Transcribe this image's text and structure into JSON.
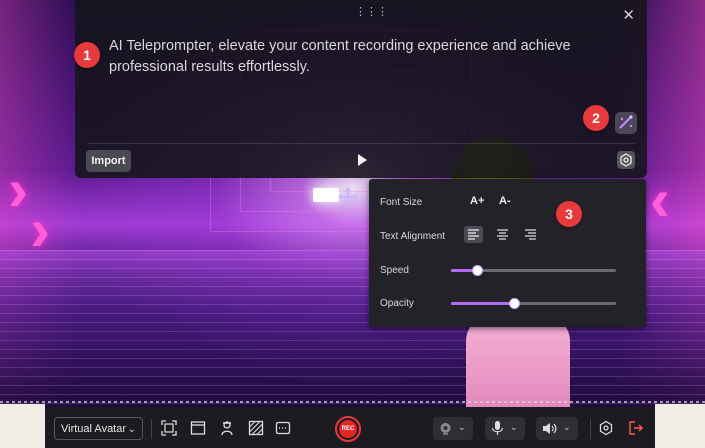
{
  "teleprompter": {
    "text": "AI Teleprompter, elevate your content recording experience and achieve professional results effortlessly.",
    "import_label": "Import",
    "close_icon": "close-icon",
    "drag_icon": "drag-handle-icon",
    "play_icon": "play-icon",
    "settings_icon": "settings-icon",
    "ai_icon": "ai-magic-icon"
  },
  "badges": {
    "b1": "1",
    "b2": "2",
    "b3": "3"
  },
  "settings": {
    "font_size_label": "Font Size",
    "font_increase": "A+",
    "font_decrease": "A-",
    "alignment_label": "Text Alignment",
    "alignment_options": [
      "left",
      "center",
      "right"
    ],
    "alignment_selected": "left",
    "speed_label": "Speed",
    "speed_value": 0.16,
    "opacity_label": "Opacity",
    "opacity_value": 0.38
  },
  "toolbar": {
    "mode_label": "Virtual Avatar",
    "rec_label": "REC",
    "icons": [
      "screen-capture-icon",
      "window-icon",
      "avatar-icon",
      "background-icon",
      "teleprompter-icon",
      "camera-icon",
      "microphone-icon",
      "speaker-icon",
      "settings-icon",
      "exit-icon"
    ]
  },
  "colors": {
    "accent": "#b16cf5",
    "rec": "#e42525",
    "badge": "#e8393d",
    "panel": "#14141a"
  }
}
